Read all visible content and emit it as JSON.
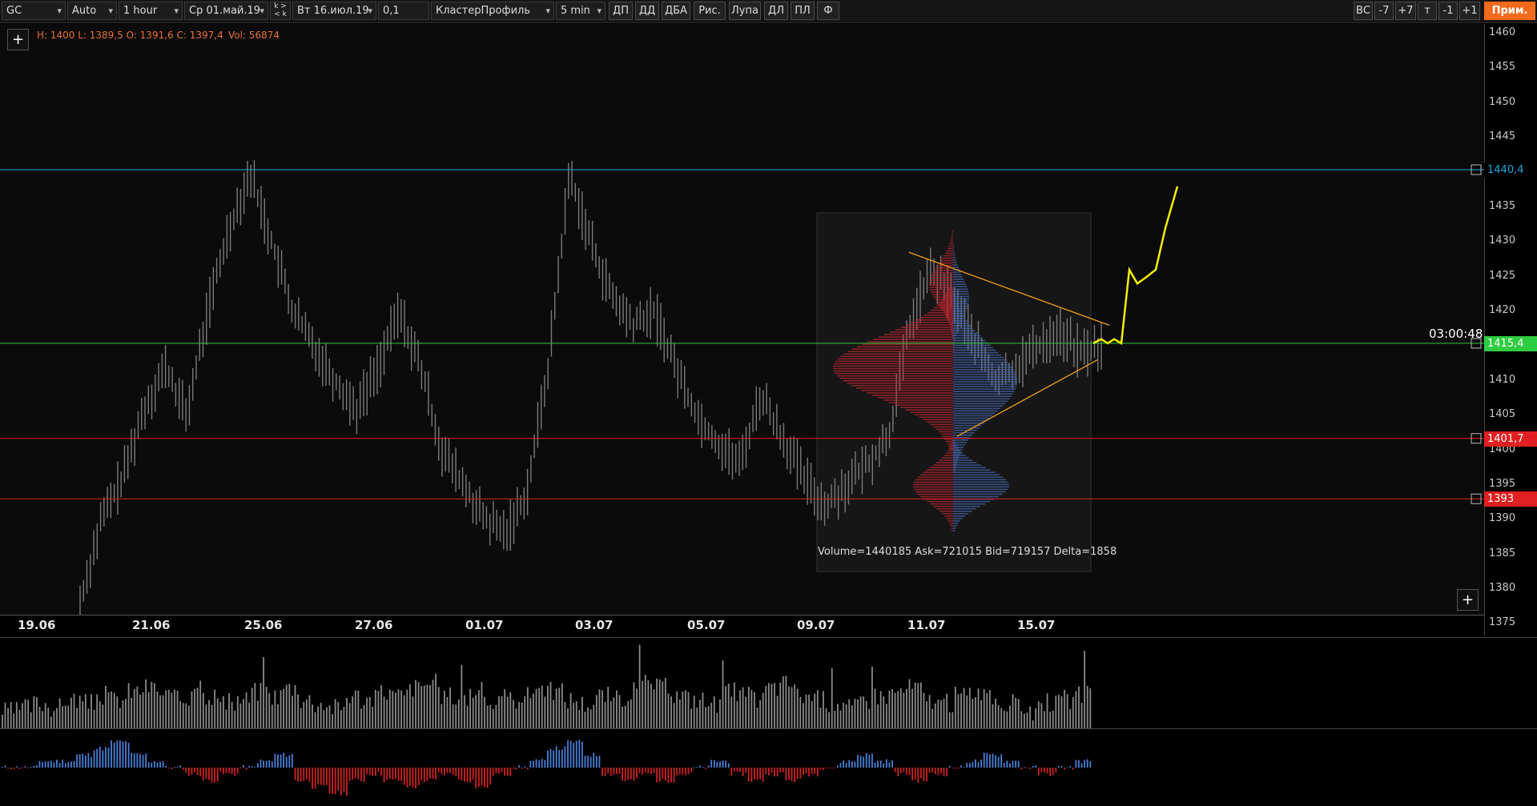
{
  "toolbar": {
    "symbol": "GC",
    "scale_mode": "Auto",
    "timeframe": "1 hour",
    "date_from": "Ср 01.май.19",
    "date_to": "Вт 16.июл.19",
    "stack_top": "k >",
    "stack_bottom": "< k",
    "tick_size": "0,1",
    "template": "КластерПрофиль",
    "profile_period": "5 min",
    "buttons": [
      "ДП",
      "ДД",
      "ДБА",
      "Рис.",
      "Лупа",
      "ДЛ",
      "ПЛ",
      "Ф"
    ],
    "right_buttons": [
      "ВС",
      "-7",
      "+7",
      "т",
      "-1",
      "+1"
    ],
    "apply_label": "Прим."
  },
  "chart": {
    "info_hloc": "H: 1400 L: 1389,5 O: 1391,6 C: 1397,4",
    "info_vol": "Vol: 56874",
    "add_top": "+",
    "add_bottom": "+",
    "timer": "03:00:48",
    "profile_stats": "Volume=1440185  Ask=721015  Bid=719157  Delta=1858",
    "price_ticks": [
      "1460",
      "1455",
      "1450",
      "1445",
      "1435",
      "1430",
      "1425",
      "1420",
      "1410",
      "1405",
      "1400",
      "1395",
      "1390",
      "1385",
      "1380",
      "1375"
    ],
    "price_tick_values": [
      1460,
      1455,
      1450,
      1445,
      1435,
      1430,
      1425,
      1420,
      1410,
      1405,
      1400,
      1395,
      1390,
      1385,
      1380,
      1375
    ],
    "levels": [
      {
        "label": "1440,4",
        "value": 1440.4,
        "color": "#1ea7e0",
        "tag_bg": "#000000",
        "tag_fg": "#1ea7e0"
      },
      {
        "label": "1415,4",
        "value": 1415.4,
        "color": "#2ecc40",
        "tag_bg": "#2ecc40",
        "tag_fg": "#ffffff"
      },
      {
        "label": "1401,7",
        "value": 1401.7,
        "color": "#e02020",
        "tag_bg": "#e02020",
        "tag_fg": "#ffffff"
      },
      {
        "label": "1393",
        "value": 1393.0,
        "color": "#e02020",
        "tag_bg": "#e02020",
        "tag_fg": "#ffffff"
      }
    ],
    "dates": [
      "19.06",
      "21.06",
      "25.06",
      "27.06",
      "01.07",
      "03.07",
      "05.07",
      "09.07",
      "11.07",
      "15.07"
    ]
  },
  "chart_data": {
    "type": "candlestick",
    "symbol": "GC",
    "timeframe": "1 hour",
    "ylim": [
      1375,
      1462
    ],
    "bars_approx_closes": [
      1378,
      1388,
      1392,
      1396,
      1405,
      1412,
      1400,
      1398,
      1420,
      1432,
      1438,
      1430,
      1422,
      1415,
      1408,
      1412,
      1406,
      1404,
      1402,
      1420,
      1415,
      1412,
      1395,
      1392,
      1388,
      1390,
      1394,
      1410,
      1438,
      1432,
      1425,
      1418,
      1420,
      1412,
      1408,
      1404,
      1402,
      1408,
      1402,
      1396,
      1392,
      1398,
      1400,
      1418,
      1424,
      1422,
      1418,
      1412,
      1410,
      1414,
      1416,
      1414,
      1415
    ],
    "price_path_x": [
      0.0,
      0.02,
      0.05,
      0.08,
      0.11,
      0.14,
      0.16,
      0.18,
      0.2,
      0.22,
      0.24,
      0.26,
      0.28,
      0.3,
      0.32,
      0.34,
      0.36,
      0.38,
      0.4,
      0.42,
      0.44,
      0.46,
      0.48,
      0.5,
      0.52,
      0.54,
      0.56,
      0.58,
      0.6,
      0.62,
      0.64,
      0.66,
      0.68,
      0.7,
      0.72,
      0.74,
      0.76,
      0.78,
      0.8,
      0.82,
      0.84,
      0.86,
      0.88,
      0.9,
      0.92,
      0.94,
      0.96,
      0.98,
      1.0
    ],
    "price_path_y": [
      1378,
      1390,
      1396,
      1406,
      1412,
      1405,
      1420,
      1432,
      1440,
      1430,
      1420,
      1415,
      1410,
      1406,
      1412,
      1420,
      1412,
      1400,
      1395,
      1390,
      1388,
      1394,
      1412,
      1440,
      1430,
      1422,
      1418,
      1420,
      1412,
      1405,
      1401,
      1398,
      1408,
      1402,
      1396,
      1392,
      1395,
      1398,
      1402,
      1418,
      1426,
      1422,
      1416,
      1410,
      1412,
      1415,
      1417,
      1414,
      1415
    ],
    "triangle_upper": [
      [
        0.0,
        1428.5
      ],
      [
        1.0,
        1418
      ]
    ],
    "triangle_lower": [
      [
        0.0,
        1402
      ],
      [
        1.0,
        1413
      ]
    ],
    "projection_path": [
      1415.4,
      1416,
      1415.4,
      1416,
      1415.4,
      1426,
      1424,
      1425,
      1426,
      1432,
      1438
    ],
    "volume_bars_rel": [
      2,
      3,
      4,
      3,
      5,
      4,
      6,
      5,
      7,
      8,
      6,
      5,
      9,
      6,
      4,
      5,
      7,
      6,
      8,
      5,
      4,
      3,
      6,
      5,
      7,
      6,
      8,
      9,
      6,
      5,
      7,
      4,
      5,
      6,
      8,
      7,
      5,
      4,
      6,
      5,
      7,
      9,
      8,
      6,
      5,
      4,
      7,
      6,
      5,
      8,
      9,
      6,
      5,
      4,
      3,
      5,
      6,
      7,
      8,
      5,
      4,
      6,
      7,
      5,
      4,
      3,
      2,
      4,
      5,
      6
    ],
    "delta_bars_rel": [
      0,
      0,
      1,
      1,
      2,
      3,
      4,
      2,
      1,
      0,
      -1,
      -2,
      -1,
      0,
      1,
      2,
      -2,
      -3,
      -4,
      -2,
      -1,
      -2,
      -3,
      -2,
      -1,
      -2,
      -3,
      -1,
      0,
      1,
      3,
      4,
      2,
      -1,
      -2,
      -1,
      -2,
      -1,
      0,
      1,
      -1,
      -2,
      -1,
      -2,
      -1,
      0,
      1,
      2,
      1,
      -1,
      -2,
      -1,
      0,
      1,
      2,
      1,
      0,
      -1,
      0,
      1
    ]
  }
}
